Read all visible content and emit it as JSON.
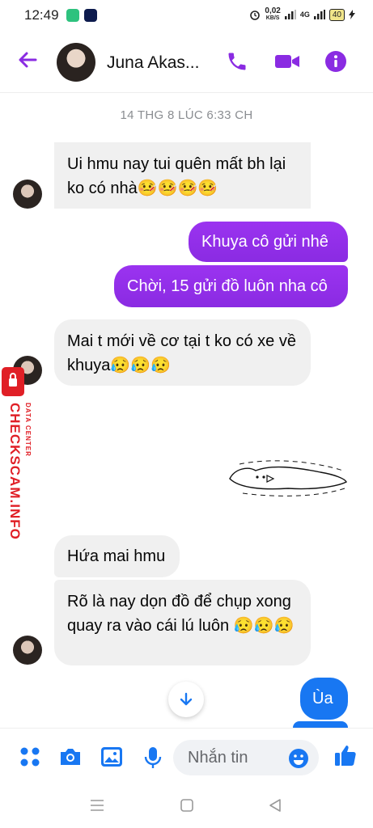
{
  "status_bar": {
    "time": "12:49",
    "net_speed_value": "0,02",
    "net_speed_unit": "KB/S",
    "network_label": "4G",
    "battery": "40"
  },
  "header": {
    "contact_name": "Juna Akas...",
    "accent_color": "#8a2be2"
  },
  "conversation": {
    "timestamp": "14 THG 8 LÚC 6:33 CH",
    "messages": [
      {
        "direction": "incoming",
        "text": "Ui hmu nay tui quên mất bh lại ko có nhà🤒🤒🤒🤒"
      },
      {
        "direction": "outgoing",
        "text": "Khuya cô gửi nhê"
      },
      {
        "direction": "outgoing",
        "text": "Chời, 15 gửi đồ luôn nha cô"
      },
      {
        "direction": "incoming",
        "text": "Mai t mới về cơ tại t ko có xe về khuya😥😥😥"
      },
      {
        "direction": "incoming",
        "text": "Hứa mai hmu"
      },
      {
        "direction": "incoming",
        "text": "Rõ là nay dọn đồ để chụp xong quay ra vào cái lú luôn 😥😥😥"
      },
      {
        "direction": "outgoing",
        "text": "Ùa"
      }
    ]
  },
  "composer": {
    "placeholder": "Nhắn tin"
  },
  "watermark": {
    "main": "CHECKSCAM.INFO",
    "sub": "DATA CENTER"
  }
}
